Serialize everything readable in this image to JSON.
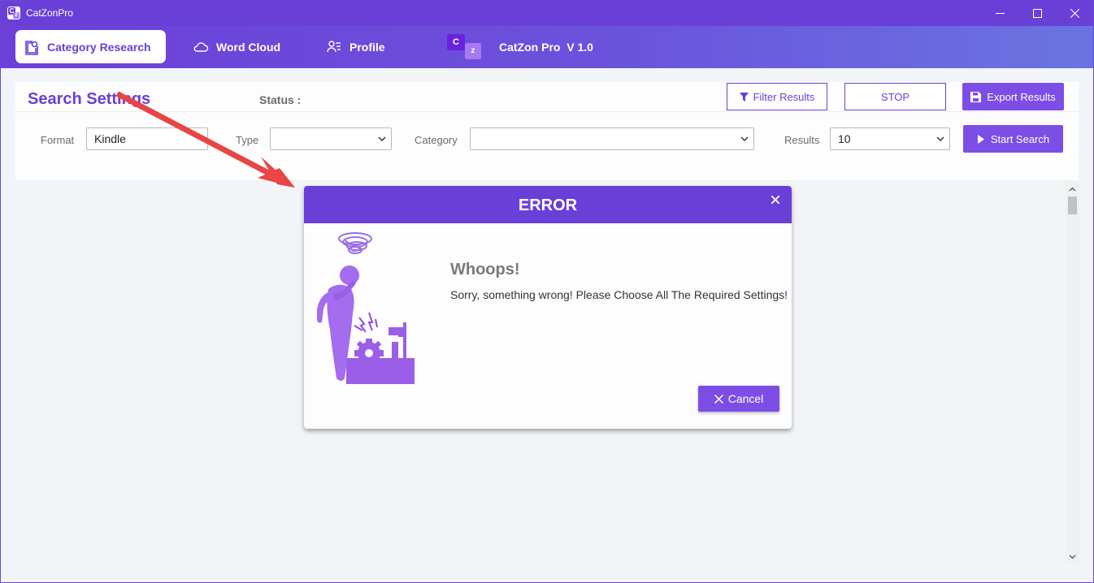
{
  "window": {
    "title": "CatZonPro",
    "logo_letters": [
      "C",
      "z"
    ]
  },
  "nav": {
    "tabs": [
      {
        "label": "Category Research",
        "icon": "category-research-icon",
        "active": true
      },
      {
        "label": "Word Cloud",
        "icon": "cloud-icon",
        "active": false
      },
      {
        "label": "Profile",
        "icon": "profile-icon",
        "active": false
      }
    ],
    "brand_letters": [
      "C",
      "z"
    ],
    "brand_name": "CatZon Pro  V 1.0"
  },
  "settings": {
    "title": "Search Settings",
    "status_label": "Status :",
    "filter_button": "Filter Results",
    "stop_button": "STOP",
    "export_button": "Export Results",
    "start_button": "Start Search",
    "format_label": "Format",
    "format_value": "Kindle",
    "type_label": "Type",
    "type_value": "",
    "category_label": "Category",
    "category_value": "",
    "results_label": "Results",
    "results_value": "10"
  },
  "modal": {
    "title": "ERROR",
    "heading": "Whoops!",
    "message": "Sorry, something wrong! Please Choose All The Required Settings!",
    "cancel_label": "Cancel"
  },
  "colors": {
    "accent": "#6a3fd8",
    "button": "#7d4ee6",
    "arrow": "#e84545"
  }
}
